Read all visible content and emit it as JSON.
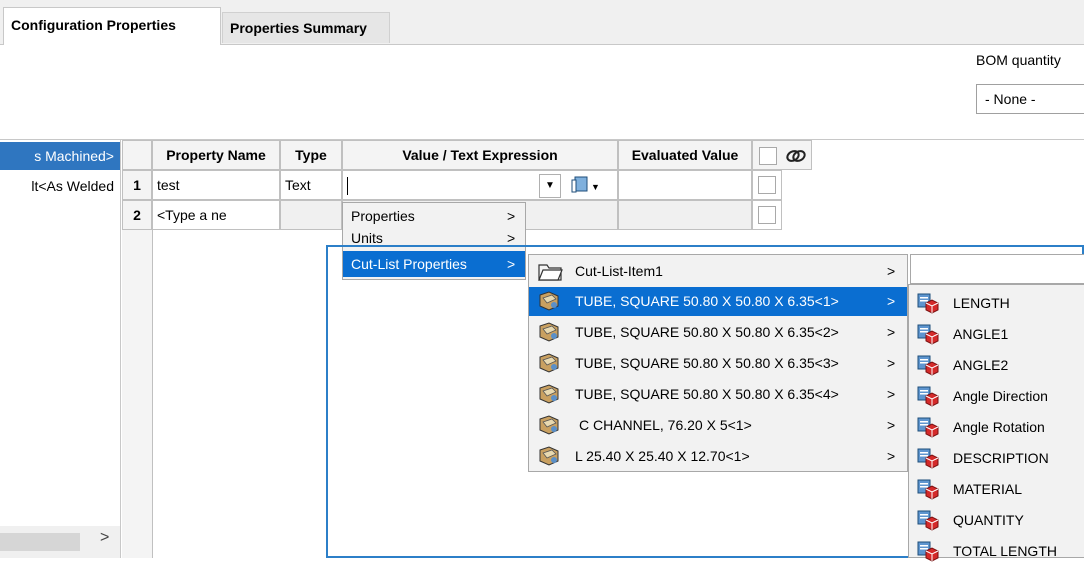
{
  "tabs": {
    "config_properties": "Configuration Properties",
    "properties_summary": "Properties Summary"
  },
  "bom": {
    "label": "BOM quantity",
    "value": "- None -"
  },
  "config_list": {
    "item_selected": "s Machined>",
    "item_2": "lt<As Welded"
  },
  "grid": {
    "headers": {
      "property_name": "Property Name",
      "type": "Type",
      "value_expression": "Value / Text Expression",
      "evaluated_value": "Evaluated Value",
      "link": "link-icon"
    },
    "rows": [
      {
        "num": "1",
        "name": "test",
        "type": "Text"
      },
      {
        "num": "2",
        "name": "<Type a ne",
        "type": ""
      }
    ]
  },
  "menu_main": [
    {
      "label": "Properties",
      "arrow": ">"
    },
    {
      "label": "Units",
      "arrow": ">"
    },
    {
      "label": "Cut-List Properties",
      "arrow": ">"
    }
  ],
  "menu_cutlist_folder": {
    "label": "Cut-List-Item1",
    "arrow": ">"
  },
  "menu_cutlist_items": [
    {
      "label": "TUBE, SQUARE 50.80 X 50.80 X 6.35<1>",
      "arrow": ">"
    },
    {
      "label": "TUBE, SQUARE 50.80 X 50.80 X 6.35<2>",
      "arrow": ">"
    },
    {
      "label": "TUBE, SQUARE 50.80 X 50.80 X 6.35<3>",
      "arrow": ">"
    },
    {
      "label": "TUBE, SQUARE 50.80 X 50.80 X 6.35<4>",
      "arrow": ">"
    },
    {
      "label": "C CHANNEL, 76.20 X 5<1>",
      "arrow": ">"
    },
    {
      "label": "L 25.40 X 25.40 X 12.70<1>",
      "arrow": ">"
    }
  ],
  "menu_properties": [
    "LENGTH",
    "ANGLE1",
    "ANGLE2",
    "Angle Direction",
    "Angle Rotation",
    "DESCRIPTION",
    "MATERIAL",
    "QUANTITY",
    "TOTAL LENGTH"
  ],
  "scroll": {
    "arrow": ">"
  },
  "colors": {
    "selection": "#0a6ed1",
    "highlight_box": "#2c7fc8",
    "left_selected": "#2f76c0"
  }
}
